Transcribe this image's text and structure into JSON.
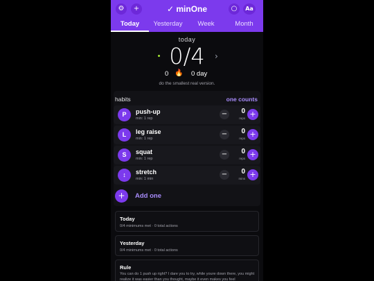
{
  "header": {
    "app_name": "minOne",
    "brand_check": "✓",
    "settings_icon": "⚙",
    "add_icon": "+",
    "theme_icon": "○",
    "font_label": "Aa",
    "colors": {
      "accent": "#7c3aed",
      "accent_light": "#a78bfa",
      "background": "#0b0b0e"
    }
  },
  "tabs": [
    {
      "label": "Today"
    },
    {
      "label": "Yesterday"
    },
    {
      "label": "Week"
    },
    {
      "label": "Month"
    }
  ],
  "hero": {
    "label": "today",
    "count": "0/4",
    "next_icon": "›",
    "streak_left": "0",
    "flame": "🔥",
    "streak_right": "0 day",
    "tagline": "do the smallest real version."
  },
  "habits": {
    "title": "habits",
    "mode": "one counts",
    "items": [
      {
        "initial": "P",
        "name": "push-up",
        "min": "min: 1 rep",
        "count": "0",
        "unit": "reps",
        "minus": "−",
        "plus": "+"
      },
      {
        "initial": "L",
        "name": "leg raise",
        "min": "min: 1 rep",
        "count": "0",
        "unit": "reps",
        "minus": "−",
        "plus": "+"
      },
      {
        "initial": "S",
        "name": "squat",
        "min": "min: 1 rep",
        "count": "0",
        "unit": "reps",
        "minus": "−",
        "plus": "+"
      },
      {
        "initial": "↕",
        "name": "stretch",
        "min": "min: 1 min",
        "count": "0",
        "unit": "mins",
        "minus": "−",
        "plus": "+"
      }
    ],
    "add_icon": "+",
    "add_label": "Add one"
  },
  "summaries": [
    {
      "title": "Today",
      "text": "0/4 minimums met · 0 total actions"
    },
    {
      "title": "Yesterday",
      "text": "0/4 minimums met · 0 total actions"
    }
  ],
  "rule": {
    "title": "Rule",
    "text": "You can do 1 push up right? I dare you to try, while youre down there, you might realize it was easier than you thought, maybe it even makes you feel"
  }
}
